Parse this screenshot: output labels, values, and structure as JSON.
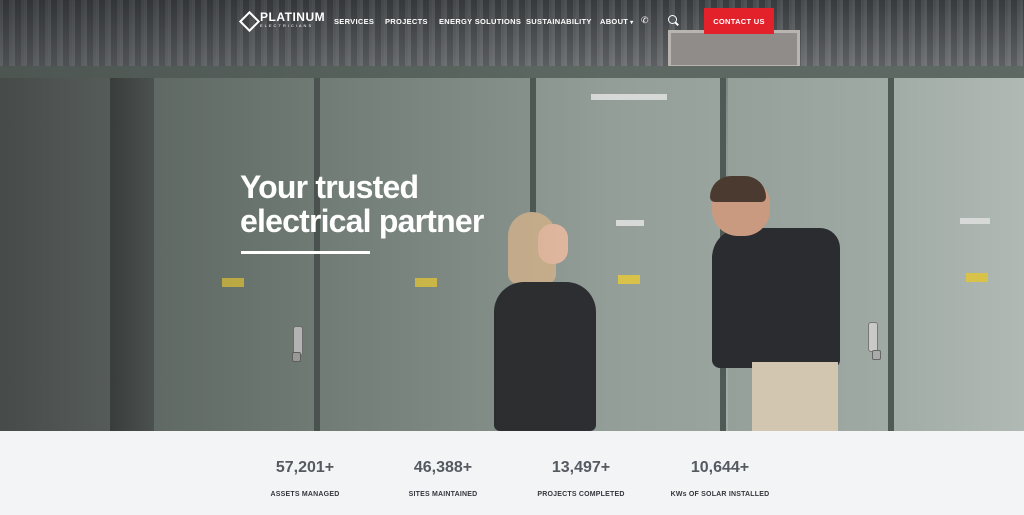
{
  "header": {
    "logo_name": "PLATINUM",
    "logo_sub": "ELECTRICIANS",
    "nav": [
      {
        "label": "SERVICES"
      },
      {
        "label": "PROJECTS"
      },
      {
        "label": "ENERGY SOLUTIONS"
      },
      {
        "label": "SUSTAINABILITY"
      },
      {
        "label": "ABOUT"
      }
    ],
    "contact_label": "CONTACT US",
    "brand_color": "#e3212b"
  },
  "hero": {
    "headline_line1": "Your trusted",
    "headline_line2": "electrical partner"
  },
  "stats": [
    {
      "value": "57,201+",
      "label": "ASSETS MANAGED"
    },
    {
      "value": "46,388+",
      "label": "SITES MAINTAINED"
    },
    {
      "value": "13,497+",
      "label": "PROJECTS COMPLETED"
    },
    {
      "value": "10,644+",
      "label": "KWs OF SOLAR INSTALLED"
    }
  ]
}
